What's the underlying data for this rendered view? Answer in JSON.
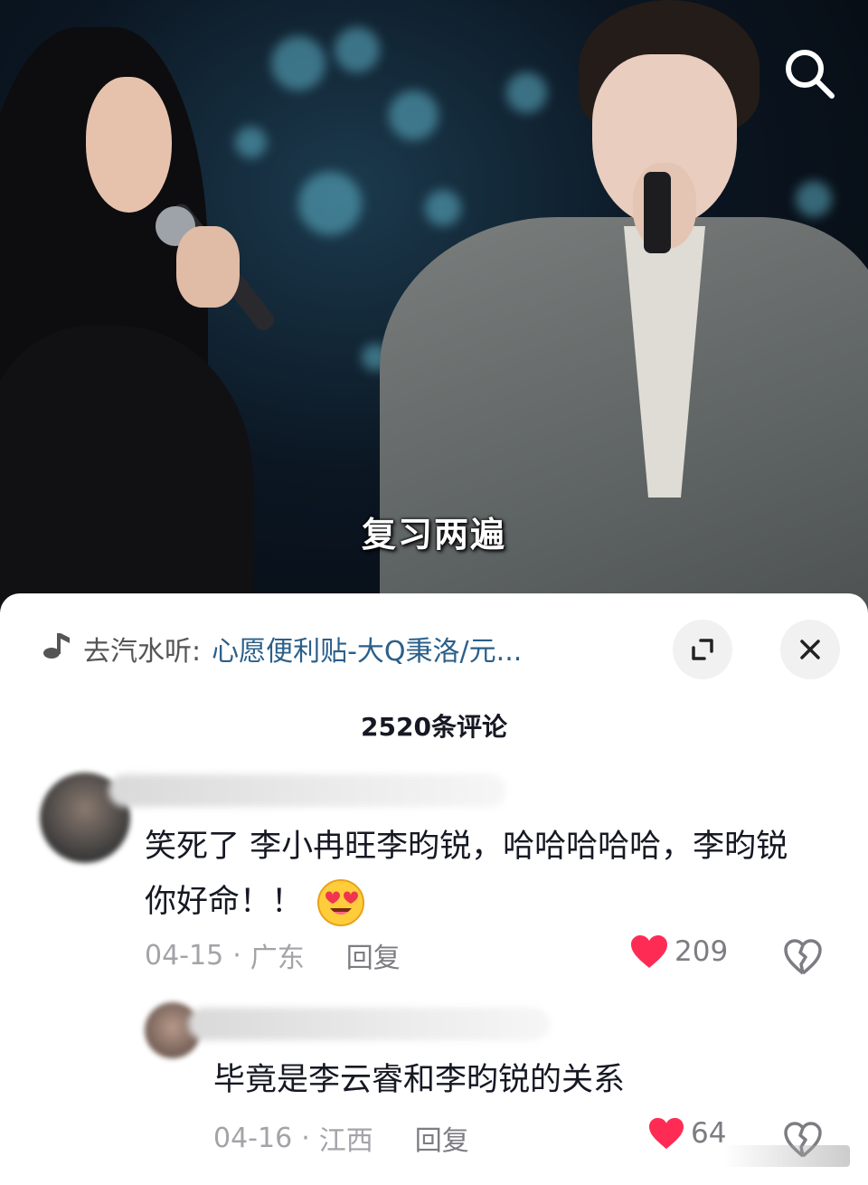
{
  "video": {
    "subtitle": "复习两遍",
    "search_icon": "search-icon"
  },
  "music_bar": {
    "icon": "music-note-icon",
    "prefix": "去汽水听:",
    "song_title": "心愿便利贴-大Q秉洛/元...",
    "expand_icon": "expand-icon",
    "close_icon": "close-icon"
  },
  "comments_header": {
    "count_label": "2520条评论"
  },
  "comments": [
    {
      "text": "笑死了 李小冉旺李昀锐，哈哈哈哈哈，李昀锐你好命！！",
      "emoji": "heart-eyes-emoji",
      "date": "04-15",
      "location": "广东",
      "reply_label": "回复",
      "likes": "209",
      "like_color": "#fe2c55"
    },
    {
      "text": "毕竟是李云睿和李昀锐的关系",
      "date": "04-16",
      "location": "江西",
      "reply_label": "回复",
      "likes": "64",
      "like_color": "#fe2c55"
    }
  ],
  "separator": "·"
}
